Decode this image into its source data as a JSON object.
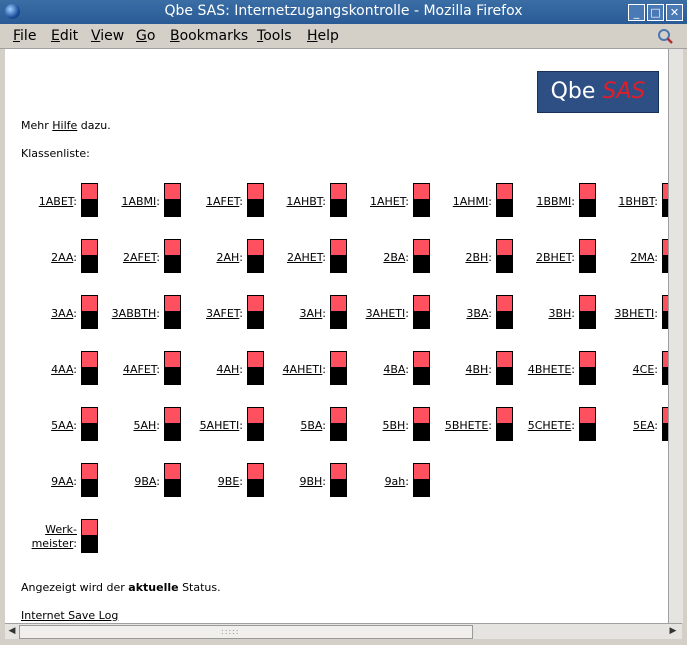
{
  "window": {
    "title": "Qbe SAS: Internetzugangskontrolle - Mozilla Firefox"
  },
  "menu": [
    "File",
    "Edit",
    "View",
    "Go",
    "Bookmarks",
    "Tools",
    "Help"
  ],
  "logo": {
    "part1": "Qbe",
    "part2": "SAS"
  },
  "help_line": {
    "prefix": "Mehr",
    "link": "Hilfe",
    "suffix": "dazu."
  },
  "list_heading": "Klassenliste:",
  "classes": [
    [
      "1ABET",
      "1ABMI",
      "1AFET",
      "1AHBT",
      "1AHET",
      "1AHMI",
      "1BBMI",
      "1BHBT"
    ],
    [
      "2AA",
      "2AFET",
      "2AH",
      "2AHET",
      "2BA",
      "2BH",
      "2BHET",
      "2MA"
    ],
    [
      "3AA",
      "3ABBTH",
      "3AFET",
      "3AH",
      "3AHETI",
      "3BA",
      "3BH",
      "3BHETI"
    ],
    [
      "4AA",
      "4AFET",
      "4AH",
      "4AHETI",
      "4BA",
      "4BH",
      "4BHETE",
      "4CE"
    ],
    [
      "5AA",
      "5AH",
      "5AHETI",
      "5BA",
      "5BH",
      "5BHETE",
      "5CHETE",
      "5EA"
    ],
    [
      "9AA",
      "9BA",
      "9BE",
      "9BH",
      "9ah"
    ]
  ],
  "werkmeister": {
    "line1": "Werk-",
    "line2": "meister"
  },
  "status_line": {
    "prefix": "Angezeigt wird der",
    "bold": "aktuelle",
    "suffix": "Status."
  },
  "log_link": "Internet Save Log",
  "colors": {
    "access_on": "#ff5060",
    "access_off": "#000000",
    "logo_bg": "#2e4f84",
    "logo_accent": "#e11d2a"
  }
}
